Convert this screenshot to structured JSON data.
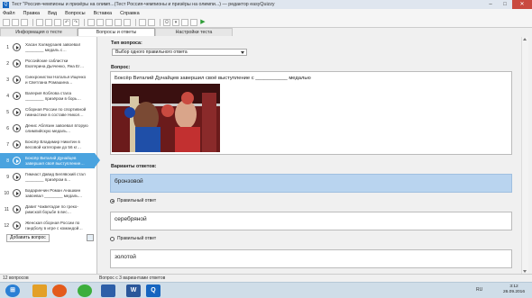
{
  "window": {
    "title": "Тест \"Россия-чемпионы и призёры на олимп...(Тест Россия-чемпионы и призёры на олимпи...) — редактор easyQuizzy",
    "minimize": "–",
    "maximize": "□",
    "close": "✕"
  },
  "menu": [
    "Файл",
    "Правка",
    "Вид",
    "Вопросы",
    "Вставка",
    "Справка"
  ],
  "tabs": [
    "Информация о тесте",
    "Вопросы и ответы",
    "Настройки теста"
  ],
  "questions": [
    {
      "num": "1",
      "text": "Хасан Халмурзаев завоевал ________ медаль с…"
    },
    {
      "num": "2",
      "text": "Российские саблистки Екатерина Дьяченко, Яна Ег…"
    },
    {
      "num": "3",
      "text": "Синхронистки Наталья Ищенко и Светлана Ромашина…"
    },
    {
      "num": "4",
      "text": "Валерия Коблова стала ________ призёром в борь…"
    },
    {
      "num": "5",
      "text": "Сборная России по спортивной гимнастике в составе Никол…"
    },
    {
      "num": "6",
      "text": "Денис Аблязин завоевал вторую олимпийскую медаль…"
    },
    {
      "num": "7",
      "text": "Боксёр Владимир Никитин в весовой категории до 56 кг…"
    },
    {
      "num": "8",
      "text": "Боксёр Виталий Дунайцев завершил своё выступление…"
    },
    {
      "num": "9",
      "text": "Гимнаст Давид Белявский стал ________ призёром в…"
    },
    {
      "num": "10",
      "text": "Бадаринчин Роман Анашкин завоевал ________ медаль…"
    },
    {
      "num": "11",
      "text": "Давит Чакветадзе по греко-римской борьбе в вес…"
    },
    {
      "num": "12",
      "text": "Женская сборная России по гандболу в игре с командой…"
    }
  ],
  "add_question_label": "Добавить вопрос",
  "editor": {
    "type_label": "Тип вопроса:",
    "type_value": "Выбор одного правильного ответа",
    "question_label": "Вопрос:",
    "question_text": "Боксёр Виталий Дунайцев  завершил своё выступление с ___________ медалью",
    "answers_label": "Варианты ответов:",
    "answers": [
      "бронзовой",
      "серебряной",
      "золотой"
    ],
    "correct_label": "Правильный ответ"
  },
  "status": {
    "count": "12 вопросов",
    "info": "Вопрос с 3 вариантами ответов"
  },
  "taskbar": {
    "word_letter": "W",
    "quizzy_letter": "Q",
    "lang": "RU",
    "time": "3:12",
    "date": "26.09.2016"
  },
  "colors": {
    "accent": "#4aa3df",
    "selected_answer": "#b9d4ef",
    "close_button": "#c94a40",
    "play_icon": "#2e9d36"
  }
}
